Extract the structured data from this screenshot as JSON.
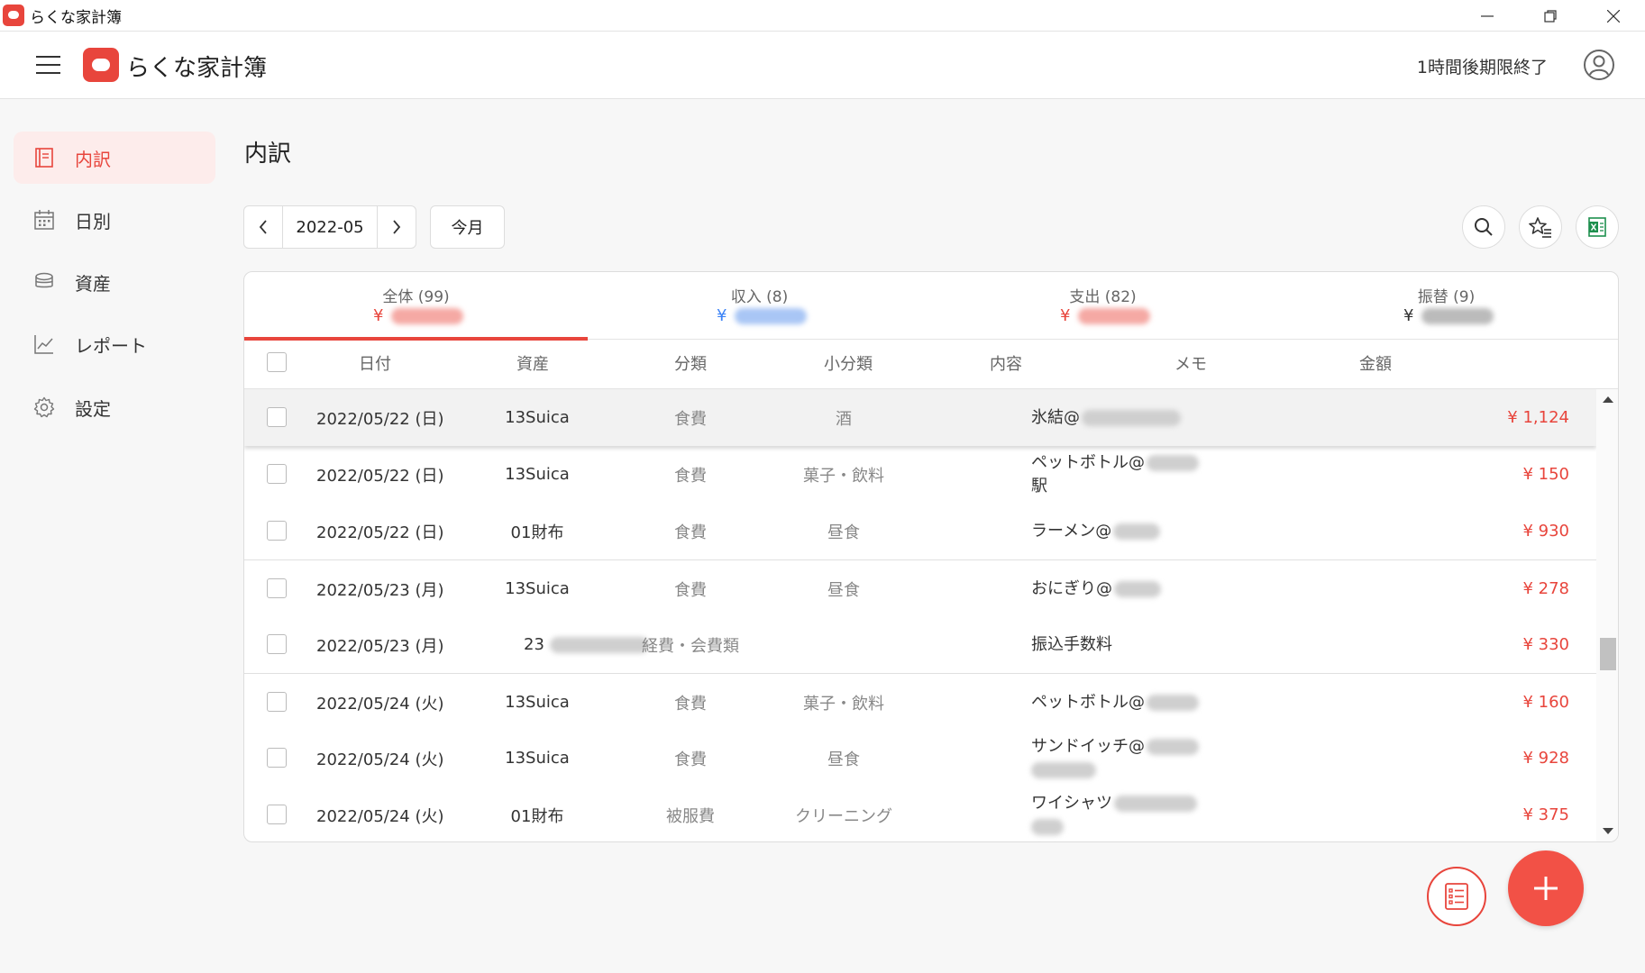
{
  "window": {
    "title": "らくな家計簿"
  },
  "header": {
    "brand": "らくな家計簿",
    "trial": "1時間後期限終了"
  },
  "sidebar": {
    "items": [
      {
        "label": "内訳",
        "icon": "book-icon",
        "active": true
      },
      {
        "label": "日別",
        "icon": "calendar-icon",
        "active": false
      },
      {
        "label": "資産",
        "icon": "coins-icon",
        "active": false
      },
      {
        "label": "レポート",
        "icon": "chart-icon",
        "active": false
      },
      {
        "label": "設定",
        "icon": "gear-icon",
        "active": false
      }
    ]
  },
  "main": {
    "title": "内訳",
    "month": "2022-05",
    "this_month": "今月",
    "tabs": [
      {
        "label": "全体 (99)",
        "yen": "¥",
        "color": "#e8453c",
        "active": true
      },
      {
        "label": "収入 (8)",
        "yen": "¥",
        "color": "#3b82f6",
        "active": false
      },
      {
        "label": "支出 (82)",
        "yen": "¥",
        "color": "#e8453c",
        "active": false
      },
      {
        "label": "振替 (9)",
        "yen": "¥",
        "color": "#333333",
        "active": false
      }
    ],
    "columns": [
      "日付",
      "資産",
      "分類",
      "小分類",
      "内容",
      "メモ",
      "金額"
    ],
    "rows": [
      {
        "date": "2022/05/22 (日)",
        "asset": "13Suica",
        "category": "食費",
        "subcategory": "酒",
        "content": "氷結@",
        "content2": "",
        "memo": "",
        "amount": "¥ 1,124"
      },
      {
        "date": "2022/05/22 (日)",
        "asset": "13Suica",
        "category": "食費",
        "subcategory": "菓子・飲料",
        "content": "ペットボトル@",
        "content2": "駅",
        "memo": "",
        "amount": "¥ 150"
      },
      {
        "date": "2022/05/22 (日)",
        "asset": "01財布",
        "category": "食費",
        "subcategory": "昼食",
        "content": "ラーメン@",
        "content2": "",
        "memo": "",
        "amount": "¥ 930"
      },
      {
        "date": "2022/05/23 (月)",
        "asset": "13Suica",
        "category": "食費",
        "subcategory": "昼食",
        "content": "おにぎり@",
        "content2": "",
        "memo": "",
        "amount": "¥ 278"
      },
      {
        "date": "2022/05/23 (月)",
        "asset": "23",
        "category": "経費・会費類",
        "subcategory": "",
        "content": "振込手数料",
        "content2": "",
        "memo": "",
        "amount": "¥ 330"
      },
      {
        "date": "2022/05/24 (火)",
        "asset": "13Suica",
        "category": "食費",
        "subcategory": "菓子・飲料",
        "content": "ペットボトル@",
        "content2": "",
        "memo": "",
        "amount": "¥ 160"
      },
      {
        "date": "2022/05/24 (火)",
        "asset": "13Suica",
        "category": "食費",
        "subcategory": "昼食",
        "content": "サンドイッチ@",
        "content2": "",
        "memo": "",
        "amount": "¥ 928"
      },
      {
        "date": "2022/05/24 (火)",
        "asset": "01財布",
        "category": "被服費",
        "subcategory": "クリーニング",
        "content": "ワイシャツ",
        "content2": "",
        "memo": "",
        "amount": "¥ 375"
      }
    ]
  },
  "colors": {
    "accent": "#e8453c",
    "income": "#3b82f6",
    "excel": "#1d8f4e"
  }
}
